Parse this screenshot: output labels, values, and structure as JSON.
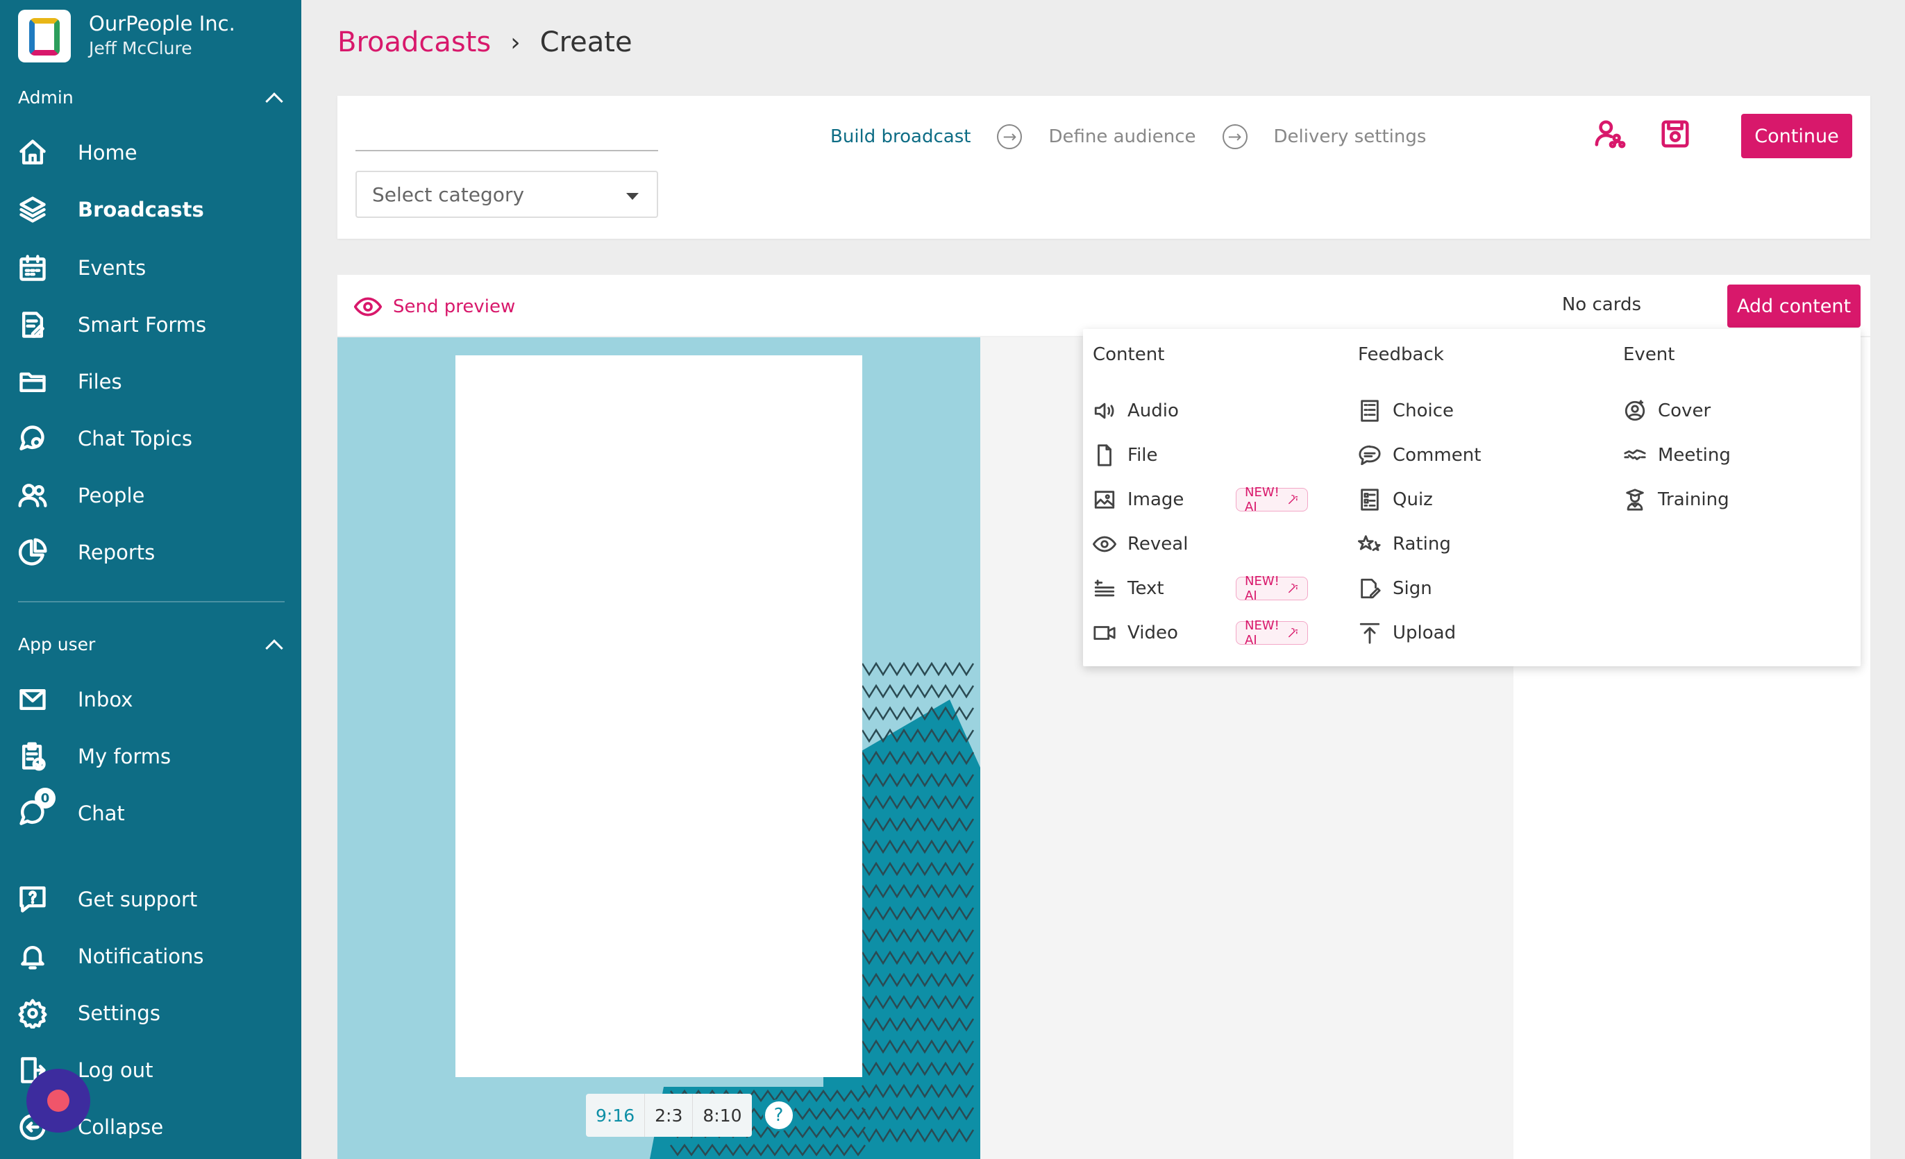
{
  "sidebar": {
    "org_name": "OurPeople Inc.",
    "user_name": "Jeff McClure",
    "admin_section": "Admin",
    "admin_items": [
      {
        "label": "Home",
        "icon": "home-icon"
      },
      {
        "label": "Broadcasts",
        "icon": "layers-icon"
      },
      {
        "label": "Events",
        "icon": "calendar-icon"
      },
      {
        "label": "Smart Forms",
        "icon": "form-icon"
      },
      {
        "label": "Files",
        "icon": "folder-icon"
      },
      {
        "label": "Chat Topics",
        "icon": "chat-topics-icon"
      },
      {
        "label": "People",
        "icon": "people-icon"
      },
      {
        "label": "Reports",
        "icon": "pie-chart-icon"
      }
    ],
    "app_user_section": "App user",
    "app_user_items": [
      {
        "label": "Inbox",
        "icon": "envelope-icon"
      },
      {
        "label": "My forms",
        "icon": "clipboard-icon"
      },
      {
        "label": "Chat",
        "icon": "chat-bubble-icon",
        "badge": "0"
      }
    ],
    "bottom_items": [
      {
        "label": "Get support",
        "icon": "support-icon"
      },
      {
        "label": "Notifications",
        "icon": "bell-icon"
      },
      {
        "label": "Settings",
        "icon": "gear-icon"
      },
      {
        "label": "Log out",
        "icon": "logout-icon"
      },
      {
        "label": "Collapse",
        "icon": "collapse-icon"
      }
    ]
  },
  "breadcrumb": {
    "parent": "Broadcasts",
    "separator": "›",
    "current": "Create"
  },
  "top_panel": {
    "category_placeholder": "Select category",
    "steps": [
      "Build broadcast",
      "Define audience",
      "Delivery settings"
    ],
    "continue_label": "Continue"
  },
  "editor": {
    "send_preview": "Send preview",
    "no_cards": "No cards",
    "add_content": "Add content",
    "ratios": [
      "9:16",
      "2:3",
      "8:10"
    ],
    "help": "?"
  },
  "dropdown": {
    "badge_label": "NEW! AI",
    "columns": [
      {
        "title": "Content",
        "items": [
          {
            "label": "Audio",
            "icon": "speaker-icon",
            "ai": false
          },
          {
            "label": "File",
            "icon": "file-icon",
            "ai": false
          },
          {
            "label": "Image",
            "icon": "image-icon",
            "ai": true
          },
          {
            "label": "Reveal",
            "icon": "eye-icon",
            "ai": false
          },
          {
            "label": "Text",
            "icon": "text-icon",
            "ai": true
          },
          {
            "label": "Video",
            "icon": "video-icon",
            "ai": true
          }
        ]
      },
      {
        "title": "Feedback",
        "items": [
          {
            "label": "Choice",
            "icon": "choice-icon"
          },
          {
            "label": "Comment",
            "icon": "comment-icon"
          },
          {
            "label": "Quiz",
            "icon": "quiz-icon"
          },
          {
            "label": "Rating",
            "icon": "stars-icon"
          },
          {
            "label": "Sign",
            "icon": "sign-icon"
          },
          {
            "label": "Upload",
            "icon": "upload-icon"
          }
        ]
      },
      {
        "title": "Event",
        "items": [
          {
            "label": "Cover",
            "icon": "cover-icon"
          },
          {
            "label": "Meeting",
            "icon": "handshake-icon"
          },
          {
            "label": "Training",
            "icon": "training-icon"
          }
        ]
      }
    ]
  },
  "colors": {
    "sidebar": "#0e6d85",
    "accent": "#d8186b",
    "canvas_bg": "#9cd3df",
    "canvas_shape": "#0e8fa6"
  }
}
